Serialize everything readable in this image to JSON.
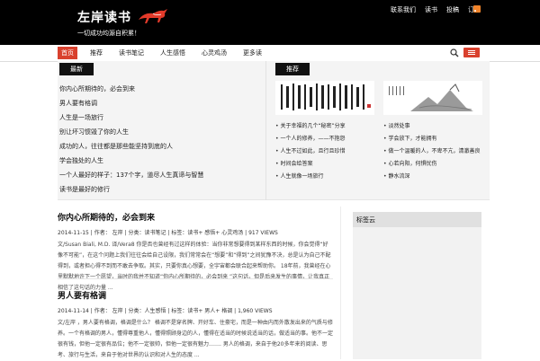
{
  "site": {
    "title": "左岸读书",
    "slogan": "一切成功均源自积累！"
  },
  "top_links": [
    "联系我们",
    "读书",
    "投稿",
    "订阅"
  ],
  "nav": {
    "items": [
      "首页",
      "推荐",
      "读书笔记",
      "人生感悟",
      "心灵鸡汤",
      "更多读"
    ],
    "active_index": 0
  },
  "left_tab_label": "最新",
  "right_tab_label": "推荐",
  "left_list": [
    "你内心所期待的，必会到来",
    "男人要有格调",
    "人生是一场旅行",
    "别让坏习惯毁了你的人生",
    "成功的人，往往都是那些能坚持到底的人",
    "学会独处的人生",
    "一个人最好的样子：137个字，道尽人生真谛与智慧",
    "读书是最好的修行"
  ],
  "right_list_left": [
    "关于幸福的几个“秘密”分享",
    "一个人的修养，——不抱怨",
    "人生不过如此，且行且珍惜",
    "时间会给答案",
    "人生就像一场旅行"
  ],
  "right_list_right": [
    "淡然处事",
    "学会放下，才能拥有",
    "做一个温暖的人，不卑不亢，清澈善良",
    "心若向阳，何惧忧伤",
    "静水流深"
  ],
  "posts": [
    {
      "title": "你内心所期待的，必会到来",
      "date": "2014-11-15",
      "author": "作者： 左岸",
      "category": "分类：读书笔记",
      "tags": "标签：读书+ 感悟+ 心灵鸡汤",
      "views": "917 VIEWS",
      "excerpt": "文/Susan Biali, M.D. 译/Vera8 你是否也曾经有过这样的体验：当你非常想要得到某样东西的时候，你会觉得“好像不可能”，在这个问题上我们往往会给自己设限，我们常常会在“想要”和“得到”之间犹豫不决，总是认为自己不配得到，或者担心得不到而不敢去争取。其实，只要你真心想要，全宇宙都会联合起来帮助你。 18年前，我曾经在心里默默地许下一个愿望，当时的我并不知道“你内心所期待的，必会到来 ”这句话，但是后来发生的事情，让我真正相信了这句话的力量 ..."
    },
    {
      "title": "男人要有格调",
      "date": "2014-11-14",
      "author": "作者： 左岸",
      "category": "分类：人生感悟",
      "tags": "标签：读书+ 男人+ 格调",
      "views": "1,960 VIEWS",
      "excerpt": "文/左岸 ，男人要有格调，格调是什么？ 格调不是穿名牌、开好车、住豪宅，而是一种由内而外散发出来的气质与修养。一个有格调的男人，懂得尊重他人，懂得照顾身边的人，懂得在适当的时候说适当的话，做适当的事。他不一定很有钱，但他一定很有品位；他不一定很帅，但他一定很有魅力……. 男人的格调，来自于他20多年来的阅读、思考、旅行与生活，来自于他对世界的认识和对人生的态度 ..."
    }
  ],
  "sidebar": {
    "title": "标签云"
  },
  "colors": {
    "accent": "#d9412e",
    "topbar": "#000000",
    "rss": "#f0832a"
  }
}
